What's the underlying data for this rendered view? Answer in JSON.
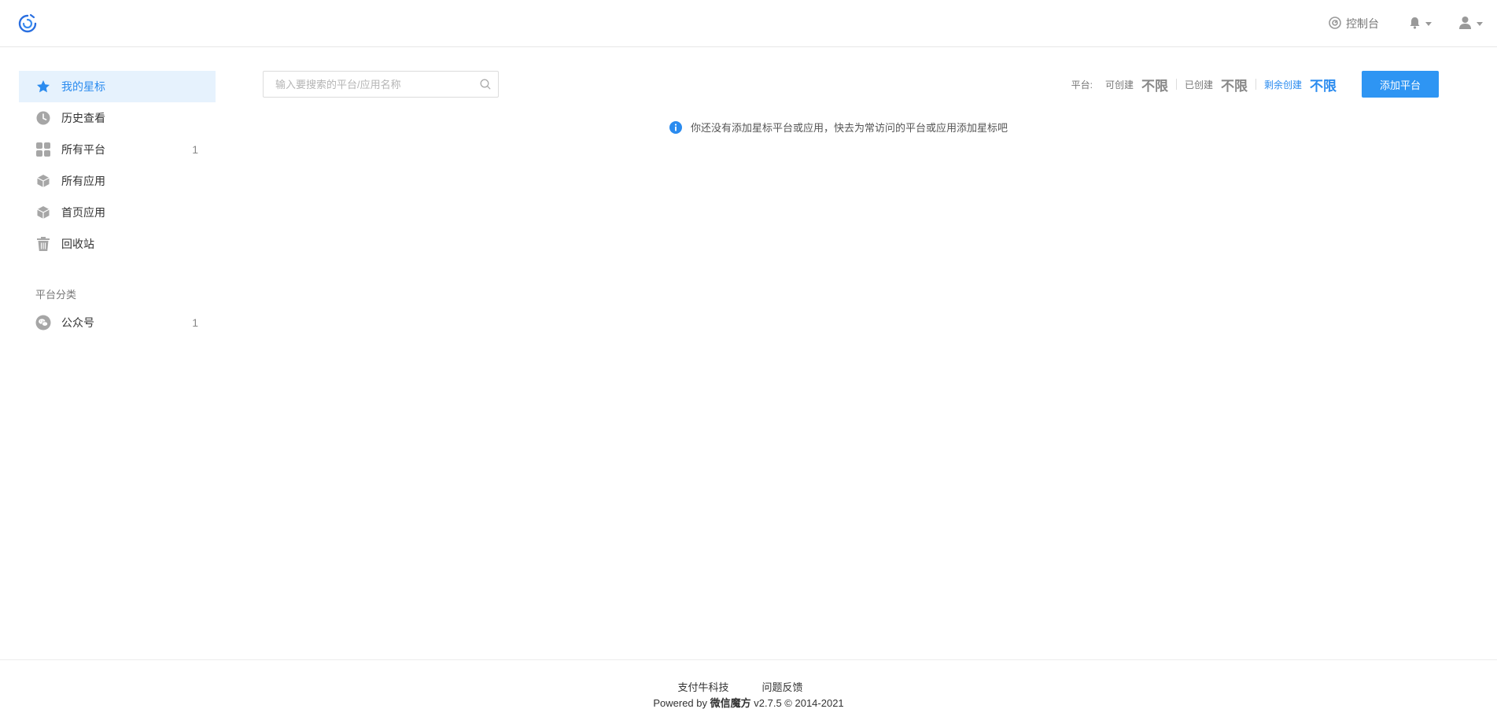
{
  "header": {
    "logo_icon": "swirl-logo-icon",
    "console_label": "控制台",
    "console_icon": "gauge-icon",
    "bell_icon": "bell-icon",
    "user_icon": "user-icon"
  },
  "sidebar": {
    "items": [
      {
        "label": "我的星标",
        "icon": "star-icon",
        "count": "",
        "active": true
      },
      {
        "label": "历史查看",
        "icon": "clock-icon",
        "count": ""
      },
      {
        "label": "所有平台",
        "icon": "grid-icon",
        "count": "1"
      },
      {
        "label": "所有应用",
        "icon": "cube-icon",
        "count": ""
      },
      {
        "label": "首页应用",
        "icon": "cube-icon",
        "count": ""
      },
      {
        "label": "回收站",
        "icon": "trash-icon",
        "count": ""
      }
    ],
    "section_title": "平台分类",
    "categories": [
      {
        "label": "公众号",
        "icon": "wechat-icon",
        "count": "1"
      }
    ]
  },
  "search": {
    "placeholder": "输入要搜索的平台/应用名称",
    "value": ""
  },
  "stats": {
    "label": "平台:",
    "can_create_label": "可创建",
    "can_create_value": "不限",
    "created_label": "已创建",
    "created_value": "不限",
    "remaining_label": "剩余创建",
    "remaining_value": "不限"
  },
  "add_button_label": "添加平台",
  "notice_text": "你还没有添加星标平台或应用，快去为常访问的平台或应用添加星标吧",
  "footer": {
    "link_company": "支付牛科技",
    "link_feedback": "问题反馈",
    "powered_prefix": "Powered by",
    "powered_brand": "微信魔方",
    "powered_suffix": "v2.7.5 © 2014-2021"
  },
  "colors": {
    "accent": "#2e95f3",
    "active_bg": "#e6f2fd",
    "icon_gray": "#a6a6a6"
  }
}
